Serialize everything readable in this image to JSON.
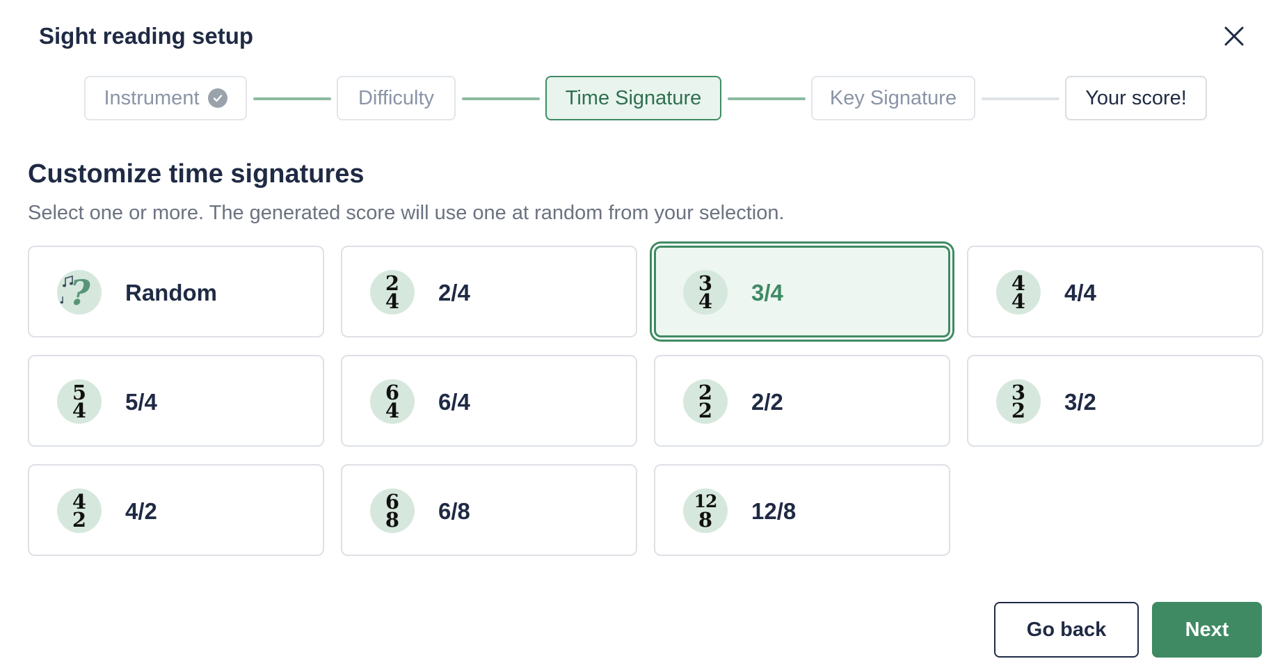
{
  "dialog": {
    "title": "Sight reading setup",
    "close_icon": "close-icon"
  },
  "stepper": {
    "steps": [
      {
        "label": "Instrument",
        "state": "completed",
        "icon": "check-circle-icon"
      },
      {
        "label": "Difficulty",
        "state": "upcoming"
      },
      {
        "label": "Time Signature",
        "state": "active"
      },
      {
        "label": "Key Signature",
        "state": "upcoming"
      },
      {
        "label": "Your score!",
        "state": "final"
      }
    ]
  },
  "section": {
    "heading": "Customize time signatures",
    "description": "Select one or more. The generated score will use one at random from your selection."
  },
  "options": [
    {
      "label": "Random",
      "icon": "random-question-music-icon",
      "selected": false
    },
    {
      "label": "2/4",
      "numerator": "2",
      "denominator": "4",
      "selected": false
    },
    {
      "label": "3/4",
      "numerator": "3",
      "denominator": "4",
      "selected": true
    },
    {
      "label": "4/4",
      "numerator": "4",
      "denominator": "4",
      "selected": false
    },
    {
      "label": "5/4",
      "numerator": "5",
      "denominator": "4",
      "selected": false
    },
    {
      "label": "6/4",
      "numerator": "6",
      "denominator": "4",
      "selected": false
    },
    {
      "label": "2/2",
      "numerator": "2",
      "denominator": "2",
      "selected": false
    },
    {
      "label": "3/2",
      "numerator": "3",
      "denominator": "2",
      "selected": false
    },
    {
      "label": "4/2",
      "numerator": "4",
      "denominator": "2",
      "selected": false
    },
    {
      "label": "6/8",
      "numerator": "6",
      "denominator": "8",
      "selected": false
    },
    {
      "label": "12/8",
      "numerator": "12",
      "denominator": "8",
      "selected": false
    }
  ],
  "footer": {
    "back_label": "Go back",
    "next_label": "Next"
  },
  "colors": {
    "accent": "#3f8a63",
    "accent_light": "#eef6f1",
    "badge_bg": "#d6e8dd",
    "text_primary": "#1f2a44",
    "text_muted": "#6b7280"
  }
}
